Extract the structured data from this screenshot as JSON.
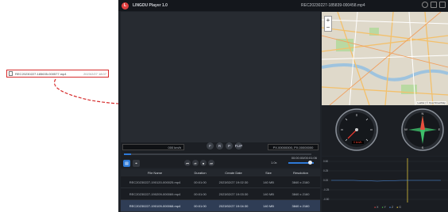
{
  "callout": {
    "filename": "REC20230227-185635-000577.mp4",
    "date": "2023/2/27 18:07"
  },
  "app": {
    "title": "LINGDU Player 1.0",
    "current_file": "REC20230227-185839-000458.mp4"
  },
  "map": {
    "zoom_in": "+",
    "zoom_out": "−",
    "attribution": "Leaflet | © OpenStreetMap"
  },
  "gauges": {
    "speed_readout": "0 km/h"
  },
  "controls": {
    "speed": "000 km/h",
    "coords": "PX.00000000, PX.00000000",
    "timecode": "00:00:00/00:01:06",
    "rate": "1.0x",
    "progress": 0.04,
    "volume": 0.85,
    "tool_buttons": [
      "F",
      "R",
      "P",
      "FLIP"
    ],
    "playback_buttons": [
      "⏮",
      "⏯",
      "⏹",
      "⏭"
    ]
  },
  "table": {
    "headers": [
      "File Name",
      "Duration",
      "Create Date",
      "Size",
      "Resolution"
    ],
    "rows": [
      {
        "file": "REC20230227-190120-000025.mp4",
        "duration": "00:01:00",
        "date": "2023/02/27 19:02:30",
        "size": "140 MB",
        "resolution": "3840 x 2160"
      },
      {
        "file": "REC20230227-190209-000069.mp4",
        "duration": "00:01:00",
        "date": "2023/02/27 19:03:30",
        "size": "140 MB",
        "resolution": "3840 x 2160"
      },
      {
        "file": "REC20230227-190109-000068.mp4",
        "duration": "00:01:00",
        "date": "2023/02/27 19:04:30",
        "size": "140 MB",
        "resolution": "3840 x 2160"
      }
    ]
  },
  "graph": {
    "y_labels": [
      "0.50",
      "0.25",
      "0.00",
      "-0.25",
      "-0.50"
    ],
    "legend": [
      "X",
      "Y",
      "Z",
      "G"
    ],
    "colors": {
      "X": "#e64a4a",
      "Y": "#4ab84a",
      "Z": "#4a8ee6",
      "G": "#e6c84a"
    }
  },
  "colors": {
    "accent": "#2e7ad8",
    "callout_red": "#d62b2b",
    "background": "#1f2329"
  }
}
